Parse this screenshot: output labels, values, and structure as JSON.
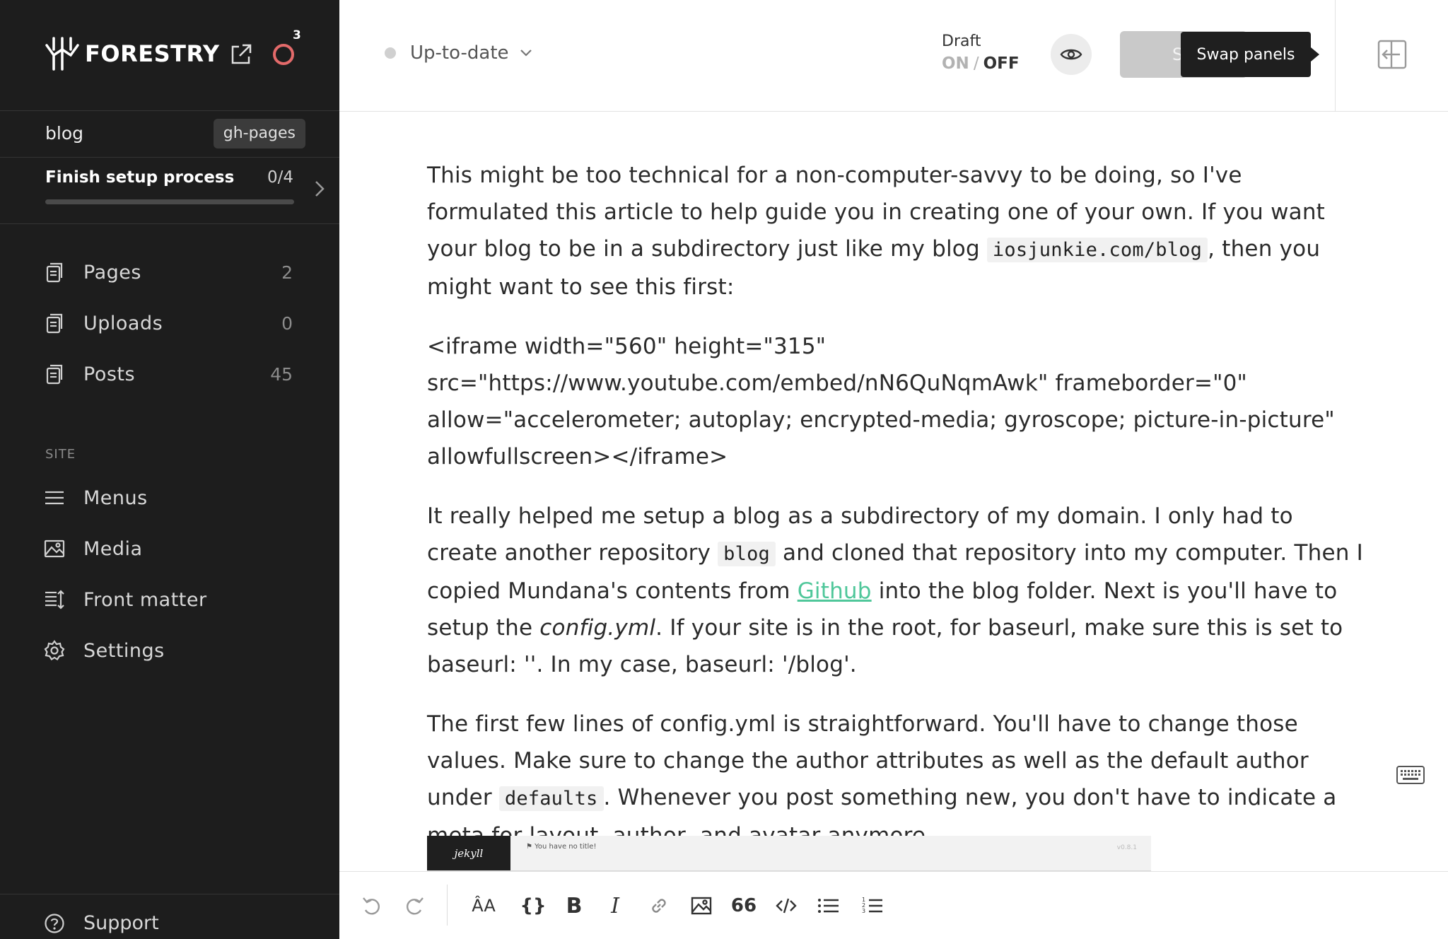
{
  "brand": {
    "name": "FORESTRY",
    "notifications": "3"
  },
  "repo": {
    "name": "blog",
    "branch": "gh-pages"
  },
  "setup": {
    "title": "Finish setup process",
    "progress_text": "0/4",
    "progress": 0
  },
  "nav": {
    "items": [
      {
        "label": "Pages",
        "count": "2",
        "icon": "document-icon"
      },
      {
        "label": "Uploads",
        "count": "0",
        "icon": "document-icon"
      },
      {
        "label": "Posts",
        "count": "45",
        "icon": "document-icon"
      }
    ],
    "section_label": "SITE",
    "site_items": [
      {
        "label": "Menus",
        "icon": "menu-icon"
      },
      {
        "label": "Media",
        "icon": "image-icon"
      },
      {
        "label": "Front matter",
        "icon": "front-matter-icon"
      },
      {
        "label": "Settings",
        "icon": "gear-icon"
      }
    ],
    "support": "Support"
  },
  "topbar": {
    "status": "Up-to-date",
    "draft_title": "Draft",
    "draft_on": "ON",
    "draft_sep": "/",
    "draft_off": "OFF",
    "save_label": "S",
    "tooltip": "Swap panels"
  },
  "content": {
    "p1_a": "This might be too technical for a non-computer-savvy to be doing, so I've formulated this article to help guide you in creating one of your own. If you want your blog to be in a subdirectory just like my blog ",
    "p1_code": "iosjunkie.com/blog",
    "p1_b": ", then you might want to see this first:",
    "p2": "<iframe width=\"560\" height=\"315\" src=\"https://www.youtube.com/embed/nN6QuNqmAwk\" frameborder=\"0\" allow=\"accelerometer; autoplay; encrypted-media; gyroscope; picture-in-picture\" allowfullscreen></iframe>",
    "p3_a": "It really helped me setup a blog as a subdirectory of my domain. I only had to create another repository ",
    "p3_code": "blog",
    "p3_b": " and cloned that repository into my computer. Then I copied Mundana's contents from ",
    "p3_link": "Github",
    "p3_c": " into the blog folder. Next is you'll have to setup the ",
    "p3_em": "config.yml",
    "p3_d": ".  If your site is in the root, for baseurl, make sure this is set to baseurl: ''. In my case, baseurl: '/blog'.",
    "p4_a": "The first few lines of config.yml is straightforward. You'll have to change those values. Make sure to change the author attributes as well as the default author under ",
    "p4_code": "defaults",
    "p4_b": ". Whenever you post something new, you don't have to indicate a meta for layout, author, and avatar anymore.",
    "embed": {
      "logo": "jekyll",
      "title": "⚑ You have no title!",
      "version": "v0.8.1"
    }
  },
  "toolbar": {
    "heading_glyph": "ÂA",
    "braces_glyph": "{}",
    "bold_glyph": "B",
    "italic_glyph": "I",
    "quote_glyph": "66"
  },
  "colors": {
    "sidebar_bg": "#1d1d1d",
    "accent_link": "#4fc79a",
    "notif_ring": "#e36a6a",
    "tooltip_bg": "#1f1f1f"
  }
}
